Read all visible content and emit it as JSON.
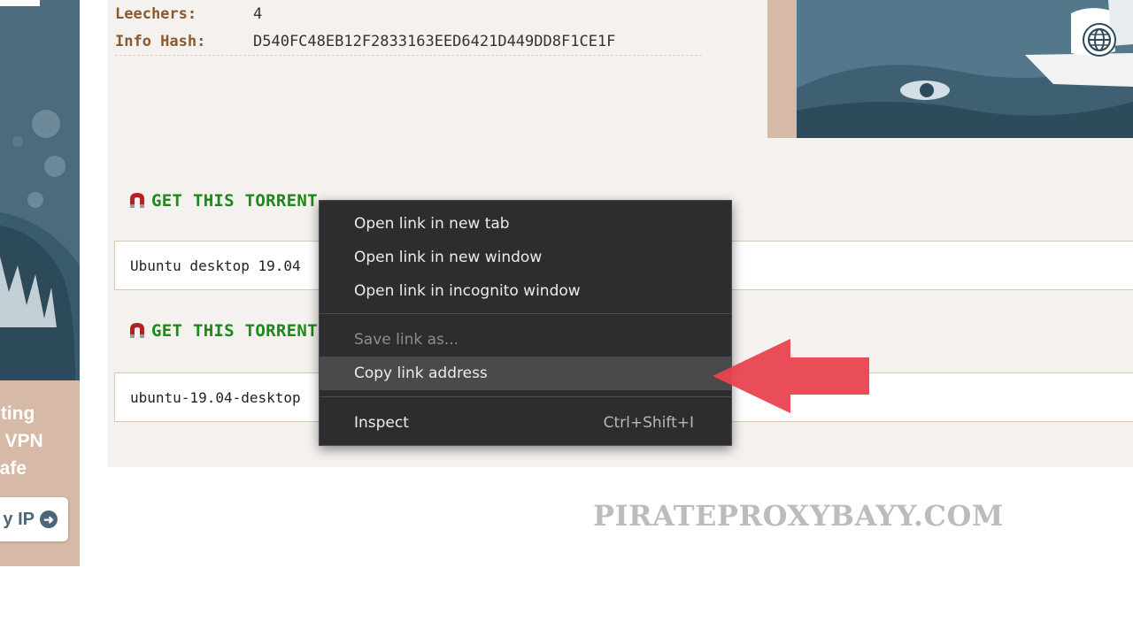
{
  "info": {
    "leechers_label": "Leechers:",
    "leechers_value": "4",
    "hash_label": "Info Hash:",
    "hash_value": "D540FC48EB12F2833163EED6421D449DD8F1CE1F"
  },
  "ad": {
    "text_lines": [
      "nting",
      "a VPN",
      "safe"
    ],
    "button_label": "y IP"
  },
  "torrents": [
    {
      "heading": "GET THIS TORRENT",
      "name": "Ubuntu desktop 19.04"
    },
    {
      "heading": "GET THIS TORRENT",
      "name": "ubuntu-19.04-desktop"
    }
  ],
  "context_menu": {
    "open_new_tab": "Open link in new tab",
    "open_new_window": "Open link in new window",
    "open_incognito": "Open link in incognito window",
    "save_link_as": "Save link as...",
    "copy_link_address": "Copy link address",
    "inspect": "Inspect",
    "inspect_shortcut": "Ctrl+Shift+I"
  },
  "watermark": "PIRATEPROXYBAYY.COM",
  "colors": {
    "label_brown": "#8a5a2e",
    "torrent_green": "#1b8a1b",
    "menu_bg": "#2d2d2f",
    "arrow_red": "#e8444f"
  },
  "icons": {
    "magnet": "magnet-icon",
    "globe": "globe-icon",
    "arrow": "arrow-right-circle-icon"
  }
}
